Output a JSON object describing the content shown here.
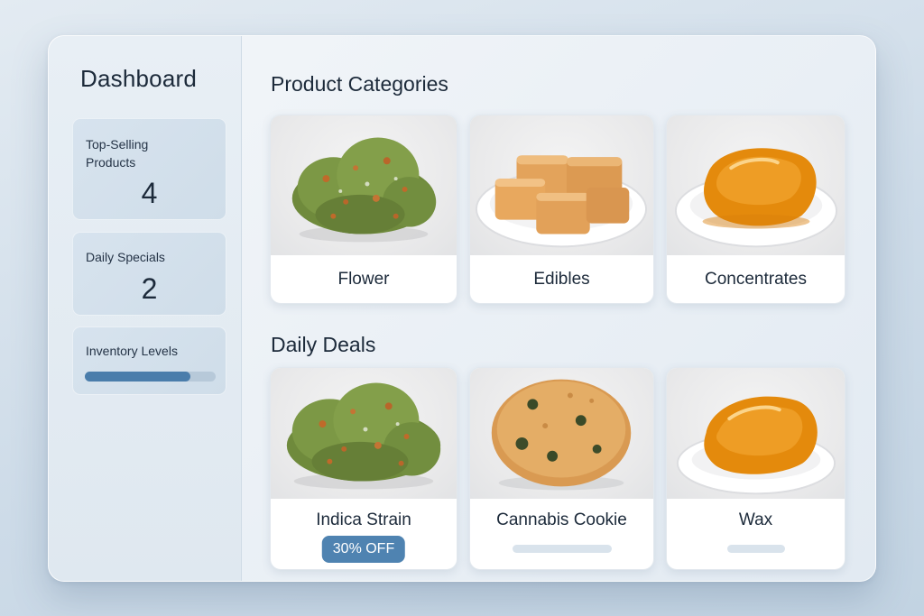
{
  "sidebar": {
    "title": "Dashboard",
    "top_selling": {
      "label_line1": "Top-Selling",
      "label_line2": "Products",
      "value": "4"
    },
    "daily_specials": {
      "label": "Daily Specials",
      "value": "2"
    },
    "inventory": {
      "label": "Inventory Levels",
      "level_fraction": 0.81
    }
  },
  "main": {
    "categories_title": "Product Categories",
    "categories": [
      {
        "name": "Flower",
        "icon": "cannabis-bud-image"
      },
      {
        "name": "Edibles",
        "icon": "gummy-cubes-image"
      },
      {
        "name": "Concentrates",
        "icon": "amber-concentrate-image"
      }
    ],
    "deals_title": "Daily Deals",
    "deals": [
      {
        "name": "Indica Strain",
        "badge": "30% OFF",
        "icon": "cannabis-bud-image"
      },
      {
        "name": "Cannabis Cookie",
        "icon": "cookie-image"
      },
      {
        "name": "Wax",
        "icon": "amber-wax-image"
      }
    ]
  },
  "colors": {
    "accent": "#4f83b1",
    "progress_fill": "#4a7dab",
    "progress_track": "#b7c9d9",
    "text": "#1c2a3a"
  }
}
